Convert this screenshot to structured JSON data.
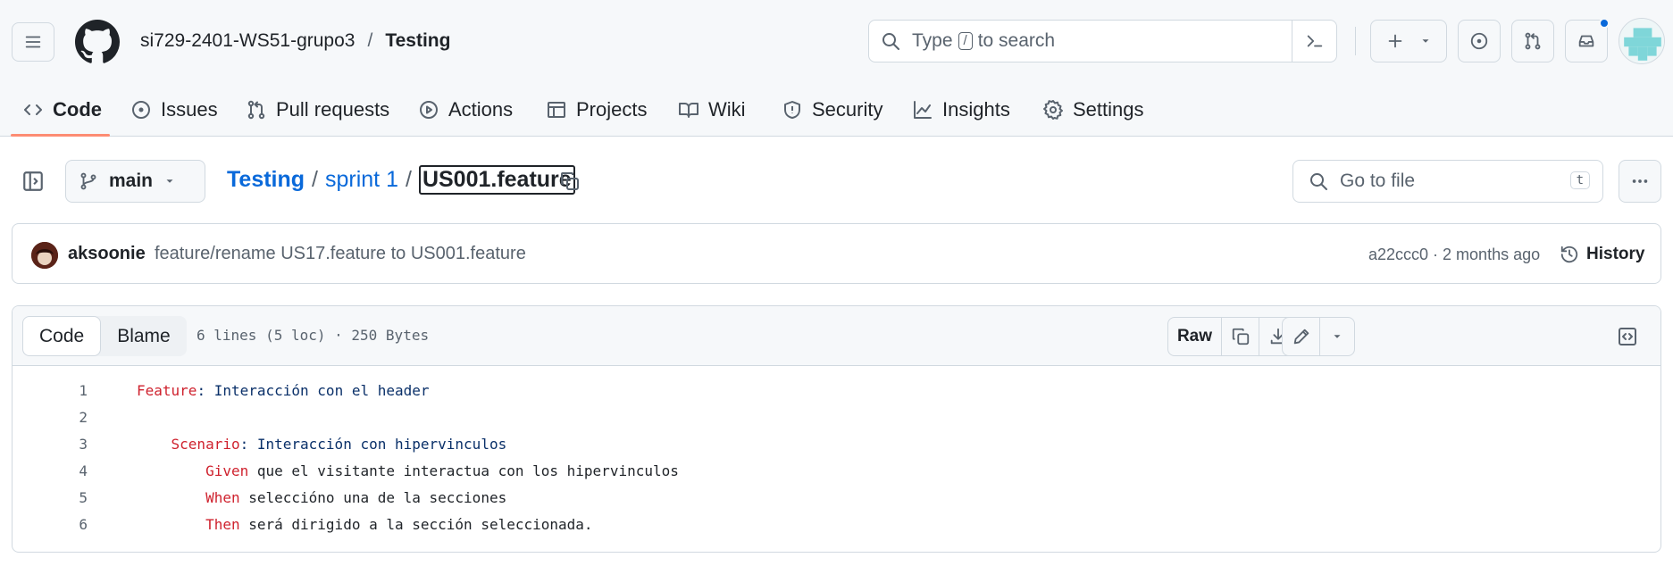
{
  "header": {
    "repo_owner": "si729-2401-WS51-grupo3",
    "separator": "/",
    "repo_name": "Testing",
    "search_prefix": "Type",
    "search_key": "/",
    "search_suffix": "to search"
  },
  "repo_nav": {
    "items": [
      {
        "label": "Code",
        "icon": "code-icon"
      },
      {
        "label": "Issues",
        "icon": "issue-icon"
      },
      {
        "label": "Pull requests",
        "icon": "pull-request-icon"
      },
      {
        "label": "Actions",
        "icon": "play-icon"
      },
      {
        "label": "Projects",
        "icon": "table-icon"
      },
      {
        "label": "Wiki",
        "icon": "book-icon"
      },
      {
        "label": "Security",
        "icon": "shield-icon"
      },
      {
        "label": "Insights",
        "icon": "graph-icon"
      },
      {
        "label": "Settings",
        "icon": "gear-icon"
      }
    ],
    "active": "Code"
  },
  "file_header": {
    "branch": "main",
    "breadcrumb": {
      "root": "Testing",
      "folder": "sprint 1",
      "file": "US001.feature",
      "sep": "/"
    },
    "goto_placeholder": "Go to file",
    "goto_key": "t"
  },
  "commit": {
    "author": "aksoonie",
    "message": "feature/rename US17.feature to US001.feature",
    "meta": "a22ccc0 · 2 months ago",
    "history_label": "History"
  },
  "code_view": {
    "tabs": [
      "Code",
      "Blame"
    ],
    "active_tab": "Code",
    "file_info": "6 lines (5 loc) · 250 Bytes",
    "raw_label": "Raw",
    "lines": [
      {
        "num": "1",
        "indent": "",
        "keyword": "Feature",
        "text": ": Interacción con el header"
      },
      {
        "num": "2",
        "indent": "",
        "keyword": "",
        "text": ""
      },
      {
        "num": "3",
        "indent": "    ",
        "keyword": "Scenario",
        "text": ": Interacción con hipervinculos"
      },
      {
        "num": "4",
        "indent": "        ",
        "keyword": "Given",
        "text": " que el visitante interactua con los hipervinculos"
      },
      {
        "num": "5",
        "indent": "        ",
        "keyword": "When",
        "text": " selecciónо una de la secciones"
      },
      {
        "num": "6",
        "indent": "        ",
        "keyword": "Then",
        "text": " será dirigido a la sección seleccionada."
      }
    ]
  },
  "colors": {
    "accent_link": "#0969da",
    "keyword": "#cf222e",
    "string": "#0a3069",
    "active_tab_underline": "#fd8c73",
    "notification": "#0969da"
  }
}
